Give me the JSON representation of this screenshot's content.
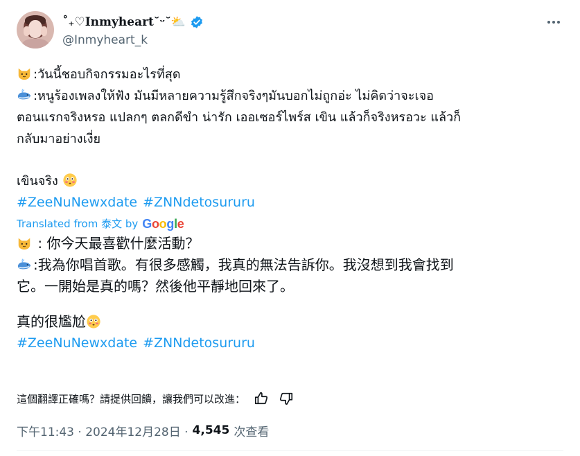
{
  "author": {
    "display_name": "˚₊♡Inmyheart˘ᵕ˘⛅",
    "handle": "@Inmyheart_k"
  },
  "tweet": {
    "thai_lines": [
      ":วันนี้ชอบกิจกรรมอะไรที่สุด",
      ":หนูร้องเพลงให้ฟัง มันมีหลายความรู้สึกจริงๆมันบอกไม่ถูกอ่ะ ไม่คิดว่าจะเจอ",
      "ตอนแรกจริงหรอ แปลกๆ ตลกดีขำ น่ารัก เออเซอร์ไพร์ส เขิน แล้วก็จริงหรอวะ แล้วก็",
      "กลับมาอย่างเงี่ย"
    ],
    "thai_closing": "เขินจริง",
    "hashtags": [
      "#ZeeNuNewxdate",
      "#ZNNdetosururu"
    ]
  },
  "translation": {
    "label": "Translated from 泰文 by",
    "provider": "Google",
    "lines": [
      " : 你今天最喜歡什麼活動？",
      ":我為你唱首歌。有很多感觸，我真的無法告訴你。我沒想到我會找到",
      "它。一開始是真的嗎？然後他平靜地回來了。"
    ],
    "closing": "真的很尷尬",
    "hashtags": [
      "#ZeeNuNewxdate",
      "#ZNNdetosururu"
    ]
  },
  "feedback": {
    "question": "這個翻譯正確嗎？請提供回饋，讓我們可以改進："
  },
  "meta": {
    "time": "下午11:43 · 2024年12月28日 ·",
    "views": "4,545",
    "views_label": "次查看"
  },
  "colors": {
    "link": "#1d9bf0",
    "secondary_text": "#536471",
    "verified": "#1d9bf0"
  },
  "icons": [
    "cat-face-emoji",
    "whale-emoji",
    "flushed-face-emoji",
    "verified-badge-icon",
    "more-icon",
    "thumbs-up-icon",
    "thumbs-down-icon"
  ]
}
